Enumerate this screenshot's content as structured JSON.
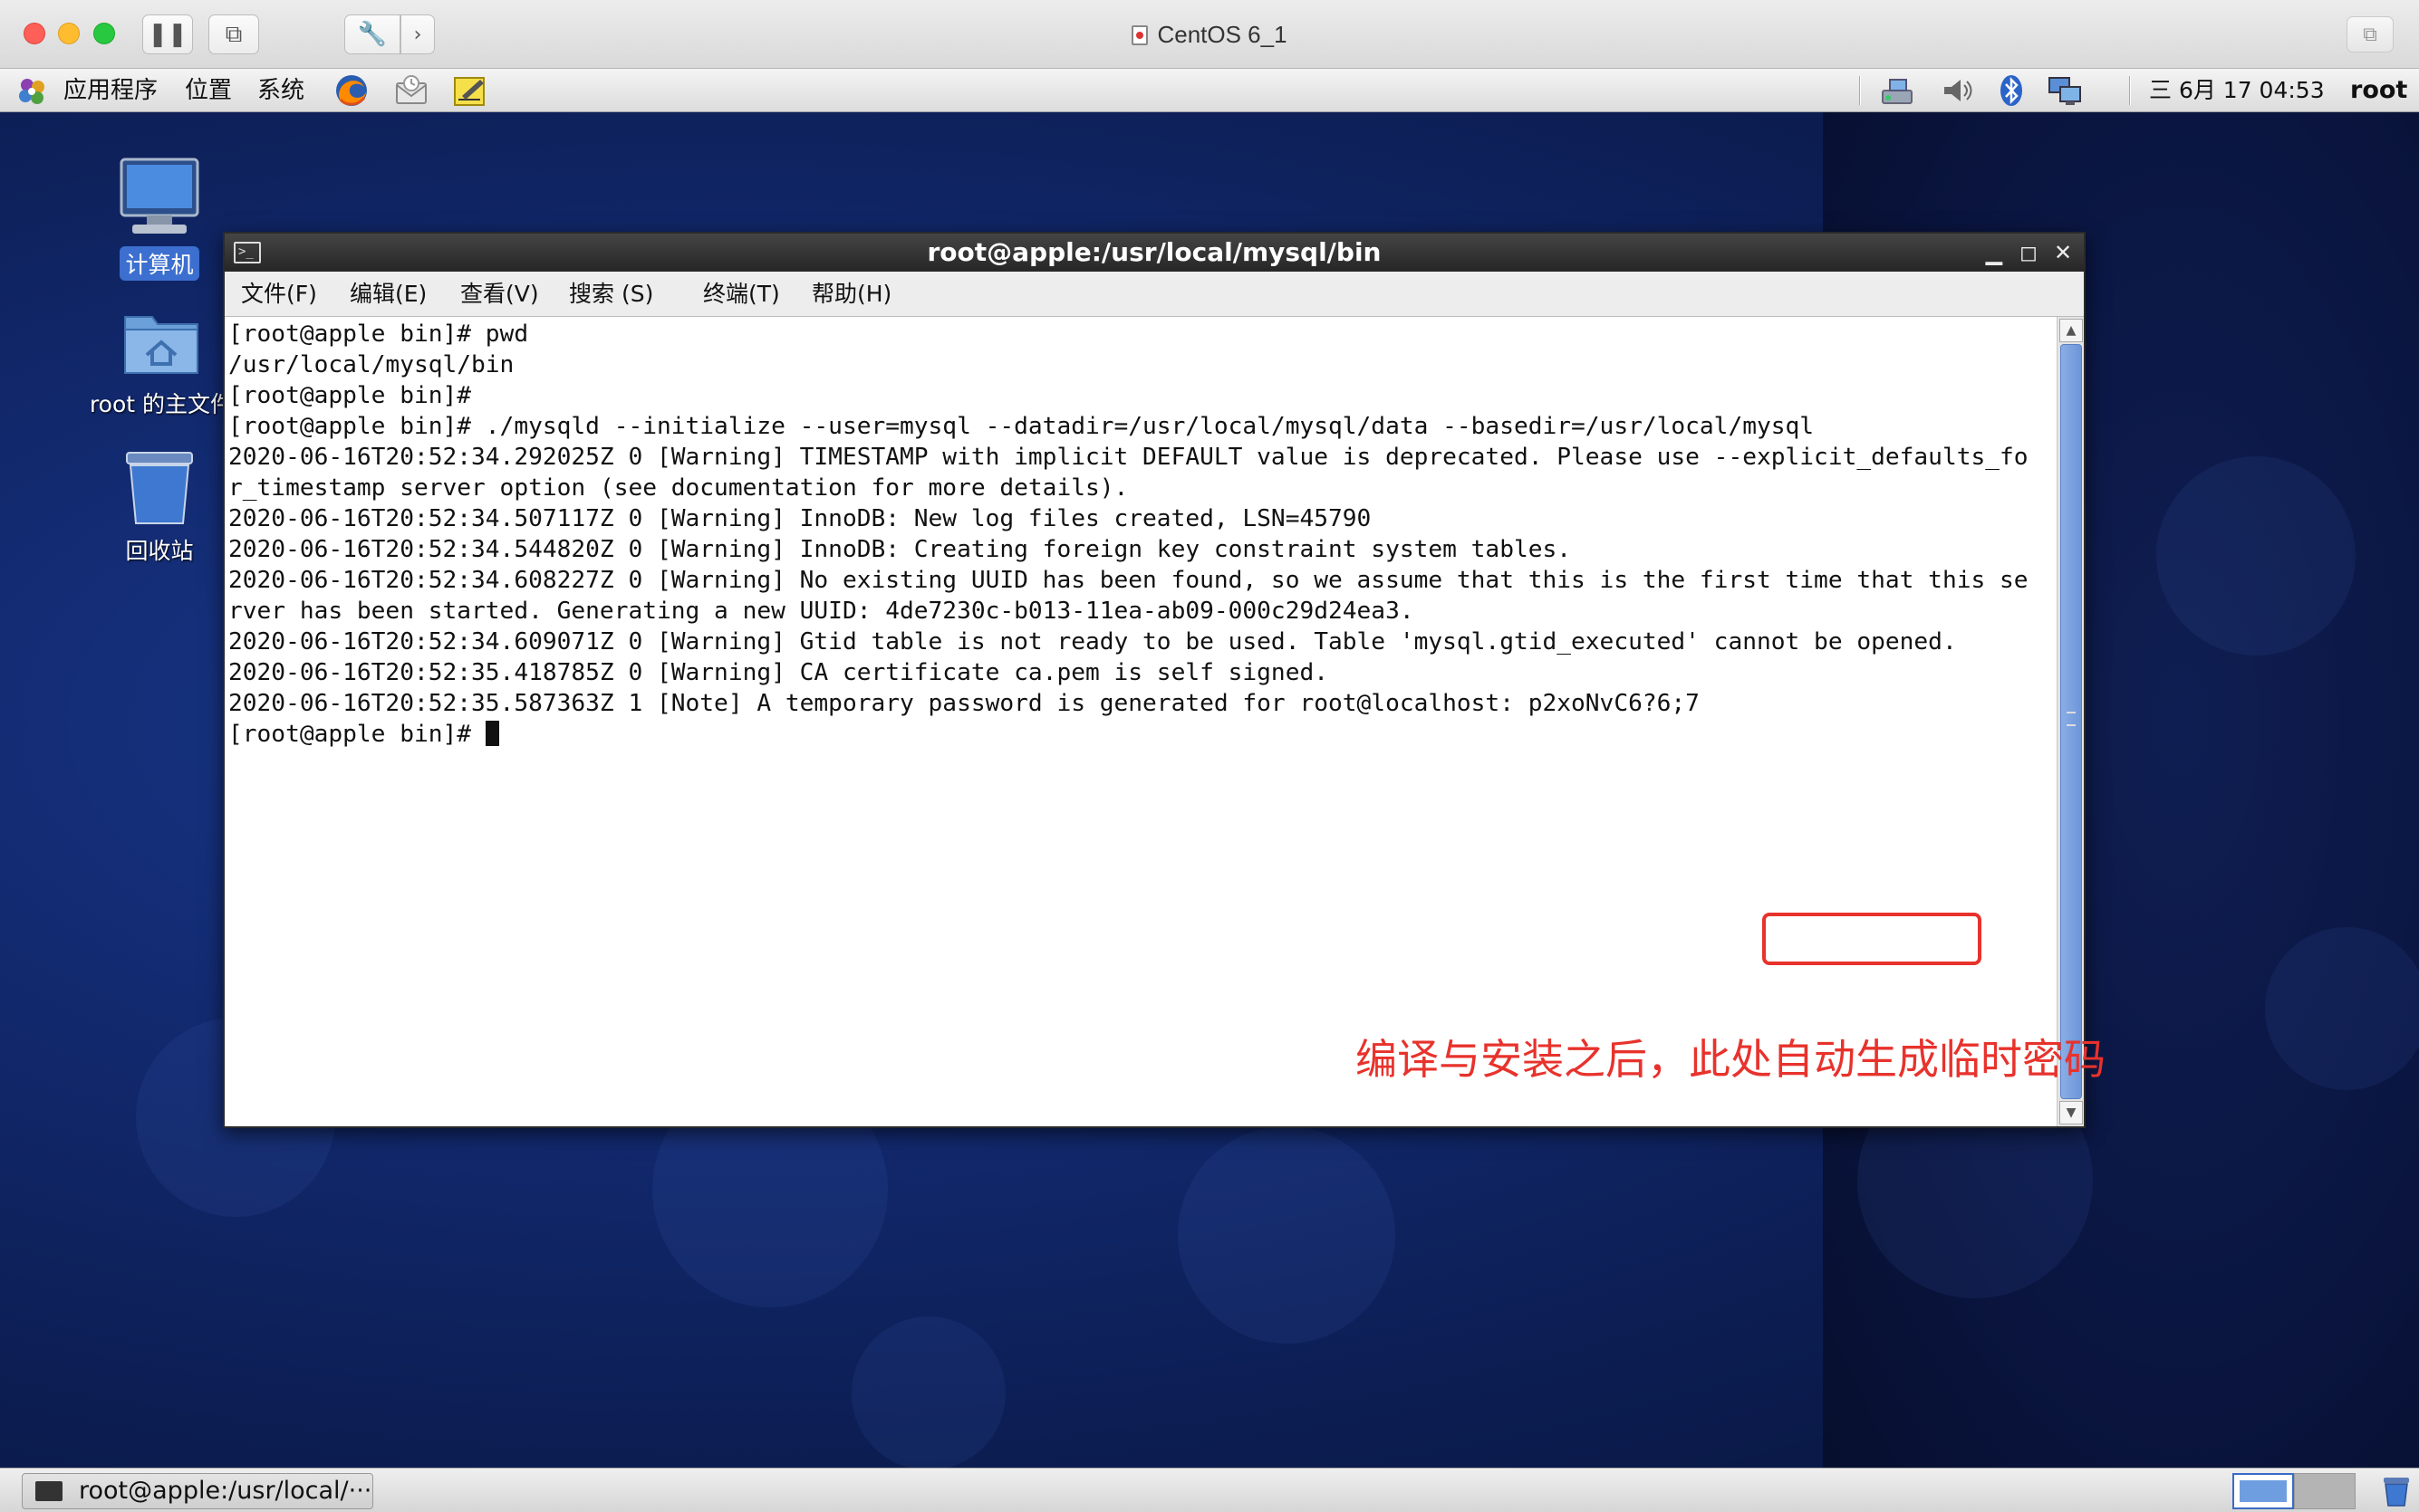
{
  "mac_window": {
    "title": "CentOS 6_1"
  },
  "gnome_panel": {
    "menus": [
      "应用程序",
      "位置",
      "系统"
    ],
    "clock": "三 6月 17 04:53",
    "user": "root"
  },
  "desktop": {
    "icons": [
      {
        "label": "计算机"
      },
      {
        "label": "root 的主文件"
      },
      {
        "label": "回收站"
      }
    ]
  },
  "terminal": {
    "title": "root@apple:/usr/local/mysql/bin",
    "menus": [
      "文件(F)",
      "编辑(E)",
      "查看(V)",
      "搜索 (S)",
      "终端(T)",
      "帮助(H)"
    ],
    "lines": [
      "[root@apple bin]# pwd",
      "/usr/local/mysql/bin",
      "[root@apple bin]#",
      "[root@apple bin]# ./mysqld --initialize --user=mysql --datadir=/usr/local/mysql/data --basedir=/usr/local/mysql",
      "2020-06-16T20:52:34.292025Z 0 [Warning] TIMESTAMP with implicit DEFAULT value is deprecated. Please use --explicit_defaults_fo",
      "r_timestamp server option (see documentation for more details).",
      "2020-06-16T20:52:34.507117Z 0 [Warning] InnoDB: New log files created, LSN=45790",
      "2020-06-16T20:52:34.544820Z 0 [Warning] InnoDB: Creating foreign key constraint system tables.",
      "2020-06-16T20:52:34.608227Z 0 [Warning] No existing UUID has been found, so we assume that this is the first time that this se",
      "rver has been started. Generating a new UUID: 4de7230c-b013-11ea-ab09-000c29d24ea3.",
      "2020-06-16T20:52:34.609071Z 0 [Warning] Gtid table is not ready to be used. Table 'mysql.gtid_executed' cannot be opened.",
      "2020-06-16T20:52:35.418785Z 0 [Warning] CA certificate ca.pem is self signed.",
      "2020-06-16T20:52:35.587363Z 1 [Note] A temporary password is generated for root@localhost: p2xoNvC6?6;7"
    ],
    "prompt": "[root@apple bin]# ",
    "annotation": "编译与安装之后，此处自动生成临时密码"
  },
  "taskbar": {
    "terminal_task": "root@apple:/usr/local/···"
  },
  "colors": {
    "annotation_red": "#e8322c",
    "terminal_title_bg": "#2e2e2e",
    "scroll_thumb": "#7aa0de"
  }
}
